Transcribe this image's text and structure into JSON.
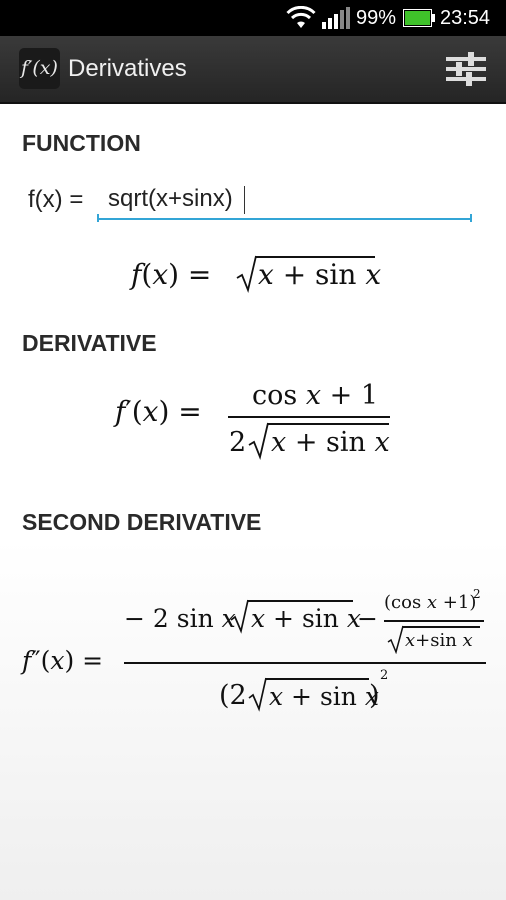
{
  "status_bar": {
    "battery_percent": "99%",
    "time": "23:54",
    "wifi_icon": "wifi-icon",
    "signal_icon": "signal-icon",
    "battery_icon": "battery-icon"
  },
  "action_bar": {
    "app_icon_text": "f′(x)",
    "title": "Derivatives",
    "settings_icon": "sliders-icon"
  },
  "function_section": {
    "label": "FUNCTION",
    "input_label": "f(x) =",
    "input_value": "sqrt(x+sinx)",
    "rendered": "f(x) = √(x + sin x)"
  },
  "derivative_section": {
    "label": "DERIVATIVE",
    "rendered": "f′(x) = (cos x + 1) / (2 √(x + sin x))"
  },
  "second_derivative_section": {
    "label": "SECOND DERIVATIVE",
    "rendered": "f″(x) = (−2 sin x √(x + sin x) − (cos x + 1)² / √(x + sin x)) / (2 √(x + sin x))²"
  },
  "colors": {
    "accent": "#33a5d6",
    "action_bar": "#2f2f2f",
    "status_bar": "#000000",
    "battery": "#3fc22a"
  }
}
